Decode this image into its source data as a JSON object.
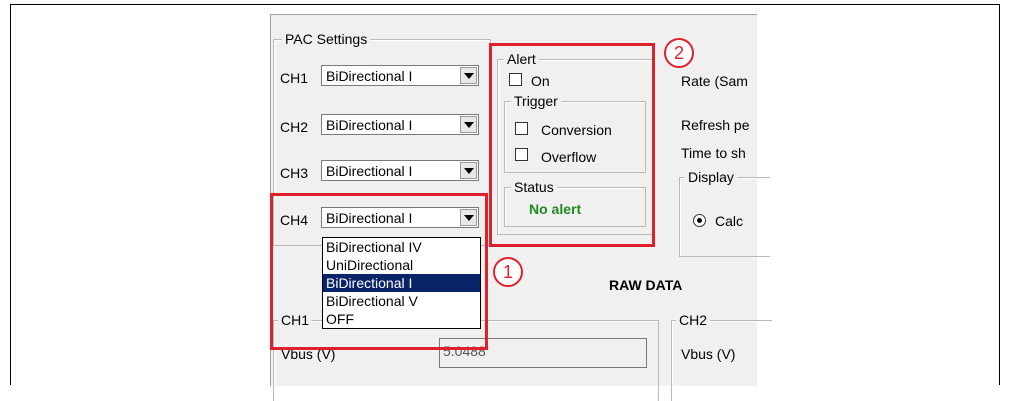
{
  "pac_settings": {
    "title": "PAC Settings",
    "channels": [
      {
        "label": "CH1",
        "value": "BiDirectional I"
      },
      {
        "label": "CH2",
        "value": "BiDirectional I"
      },
      {
        "label": "CH3",
        "value": "BiDirectional I"
      },
      {
        "label": "CH4",
        "value": "BiDirectional I"
      }
    ],
    "dropdown_options": [
      "BiDirectional IV",
      "UniDirectional",
      "BiDirectional I",
      "BiDirectional V",
      "OFF"
    ],
    "dropdown_selected": "BiDirectional I"
  },
  "alert": {
    "title": "Alert",
    "on_label": "On",
    "trigger_title": "Trigger",
    "conversion_label": "Conversion",
    "overflow_label": "Overflow",
    "status_title": "Status",
    "status_value": "No alert",
    "status_color": "#1e8c1e"
  },
  "right_panel": {
    "rate_label": "Rate (Sam",
    "refresh_label": "Refresh pe",
    "time_label": "Time to sh",
    "display_title": "Display",
    "calc_label": "Calc"
  },
  "raw_data": {
    "title": "RAW DATA",
    "ch1_title": "CH1",
    "ch2_title": "CH2",
    "vbus_label": "Vbus (V)",
    "ch1_vbus_value": "5.0488",
    "ch2_vbus_label": "Vbus (V)"
  },
  "callouts": {
    "one": "1",
    "two": "2"
  },
  "colors": {
    "highlight": "#e0202a",
    "selection": "#0a246a"
  }
}
